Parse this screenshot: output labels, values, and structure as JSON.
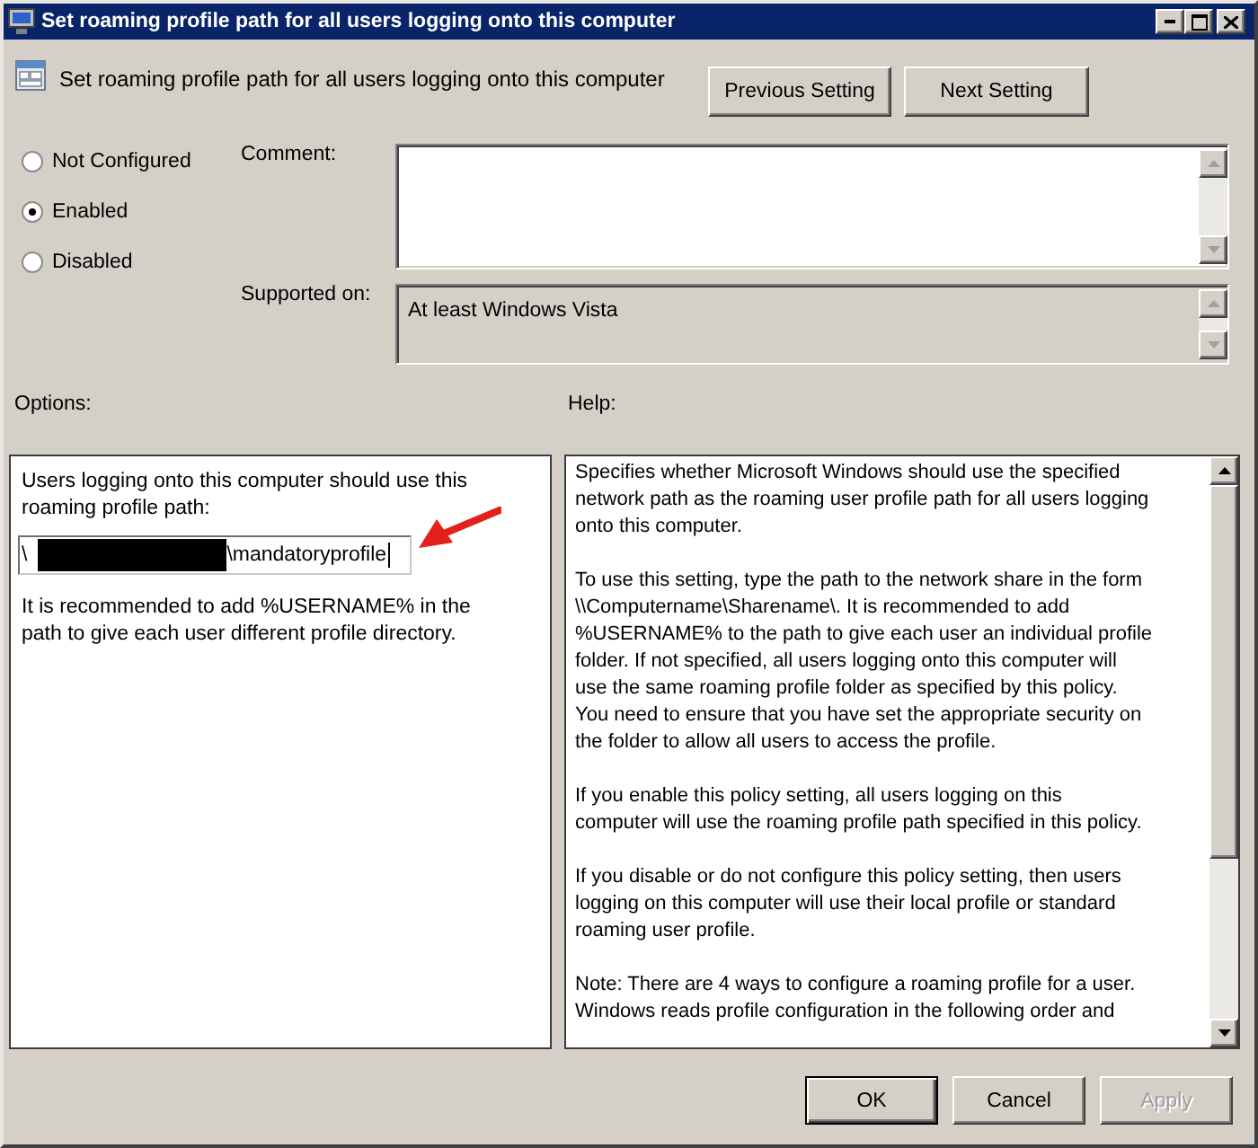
{
  "window": {
    "title": "Set roaming profile path for all users logging onto this computer",
    "controls": [
      {
        "kind": "minimize"
      },
      {
        "kind": "maximize"
      },
      {
        "kind": "close"
      }
    ]
  },
  "header": {
    "setting_name": "Set roaming profile path for all users logging onto this computer",
    "buttons": [
      {
        "label": "Previous Setting"
      },
      {
        "label": "Next Setting"
      }
    ]
  },
  "state_options": [
    {
      "label": "Not Configured",
      "selected": false
    },
    {
      "label": "Enabled",
      "selected": true
    },
    {
      "label": "Disabled",
      "selected": false
    }
  ],
  "comment": {
    "label": "Comment:"
  },
  "supported_on": {
    "label": "Supported on:",
    "value": "At least Windows Vista"
  },
  "options": {
    "label": "Options:",
    "intro": "Users logging onto this computer should use this\nroaming profile path:",
    "path_field": {
      "value_start": "\\",
      "redacted": true,
      "value_end": "\\mandatoryprofile",
      "focused": true
    },
    "note": "It is recommended to add %USERNAME% in the\npath to give each user different profile directory."
  },
  "annotations": [
    {
      "kind": "arrow"
    }
  ],
  "help": {
    "label": "Help:",
    "paragraphs": [
      "Specifies whether Microsoft Windows should use the specified\nnetwork path as the roaming user profile path for all users logging\nonto this computer.",
      "To use this setting, type the path to the network share in the form\n\\\\Computername\\Sharename\\. It is recommended to add\n%USERNAME% to the path to give each user an individual profile\nfolder. If not specified, all users logging onto this computer will\nuse the same roaming profile folder as specified by this policy.\nYou need to ensure that you have set the appropriate security on\nthe folder to allow all users to access the profile.",
      "If you enable this policy setting, all users logging on this\ncomputer will use the roaming profile path specified in this policy.",
      "If you disable or do not configure this policy setting, then users\nlogging on this computer will use their local profile or standard\nroaming user profile.",
      "Note: There are 4 ways to configure a roaming profile for a user.\nWindows reads profile configuration in the following order and"
    ]
  },
  "buttons": [
    {
      "label": "OK",
      "default": true,
      "disabled": false
    },
    {
      "label": "Cancel",
      "default": false,
      "disabled": false
    },
    {
      "label": "Apply",
      "default": false,
      "disabled": true
    }
  ]
}
